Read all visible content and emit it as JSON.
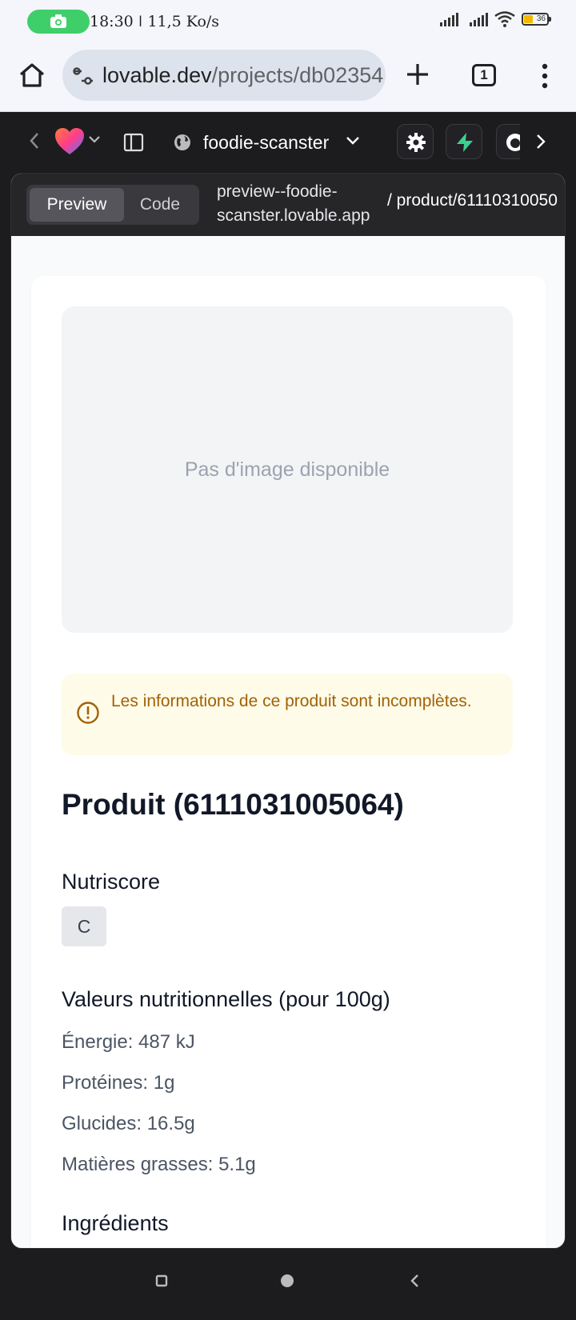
{
  "status_bar": {
    "time_speed": "18:30 ǀ 11,5 Ko/s",
    "battery": "36"
  },
  "browser": {
    "url_domain": "lovable.dev",
    "url_path": "/projects/db02354",
    "tab_count": "1"
  },
  "lovable_toolbar": {
    "project_name": "foodie-scanster"
  },
  "preview_header": {
    "preview_label": "Preview",
    "code_label": "Code",
    "host": "preview--foodie-scanster.lovable.app",
    "route": "/ product/61110310050"
  },
  "product": {
    "image_placeholder": "Pas d'image disponible",
    "alert": "Les informations de ce produit sont incomplètes.",
    "title": "Produit (6111031005064)",
    "nutriscore_heading": "Nutriscore",
    "nutriscore_value": "C",
    "nutrition_heading": "Valeurs nutritionnelles (pour 100g)",
    "nutrition": [
      "Énergie: 487 kJ",
      "Protéines: 1g",
      "Glucides: 16.5g",
      "Matières grasses: 5.1g"
    ],
    "ingredients_heading": "Ingrédients"
  },
  "colors": {
    "accent_green": "#3ecf6a",
    "alert_bg": "#fefbe8",
    "alert_text": "#a16207"
  }
}
